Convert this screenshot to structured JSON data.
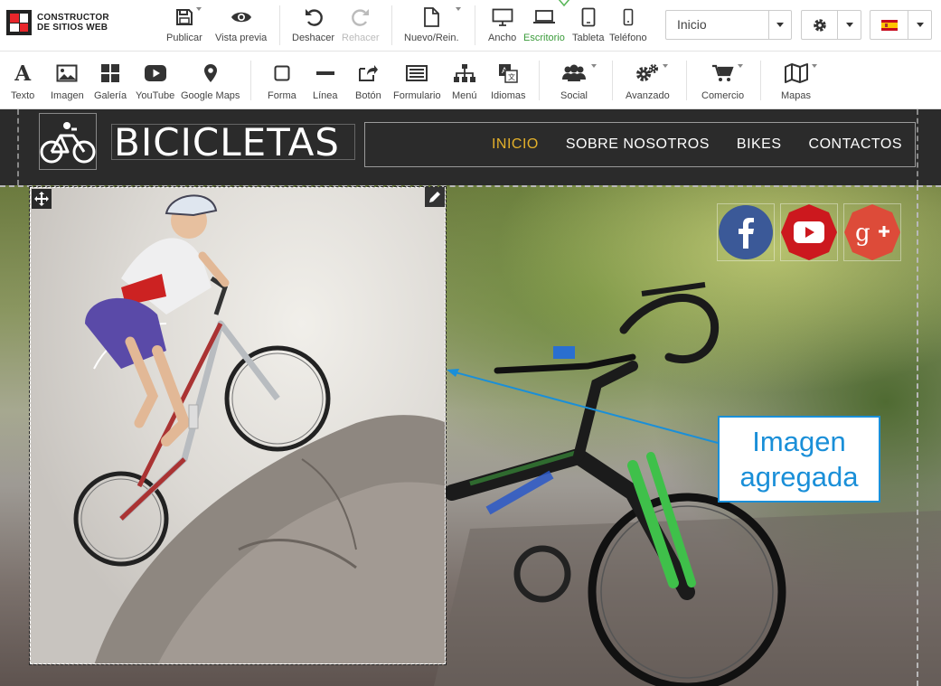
{
  "app": {
    "logo_line1": "CONSTRUCTOR",
    "logo_line2": "DE SITIOS WEB"
  },
  "topbar": {
    "publish": "Publicar",
    "preview": "Vista previa",
    "undo": "Deshacer",
    "redo": "Rehacer",
    "new_reset": "Nuevo/Rein.",
    "devices": {
      "wide": "Ancho",
      "desktop": "Escritorio",
      "tablet": "Tableta",
      "phone": "Teléfono",
      "active": "desktop"
    },
    "page_select_value": "Inicio",
    "active_color": "#3a9b3a"
  },
  "toolbar2": {
    "text": "Texto",
    "image": "Imagen",
    "gallery": "Galería",
    "youtube": "YouTube",
    "google_maps": "Google Maps",
    "shape": "Forma",
    "line": "Línea",
    "button": "Botón",
    "form": "Formulario",
    "menu": "Menú",
    "languages": "Idiomas",
    "social": "Social",
    "advanced": "Avanzado",
    "commerce": "Comercio",
    "maps": "Mapas"
  },
  "site": {
    "title": "BICICLETAS",
    "nav": [
      "INICIO",
      "SOBRE NOSOTROS",
      "BIKES",
      "CONTACTOS"
    ],
    "nav_active_color": "#e3b02a",
    "header_bg": "#2b2b2b",
    "social": {
      "facebook_color": "#3b5998",
      "youtube_color": "#cc181e",
      "googleplus_color": "#dd4b39"
    }
  },
  "annotation": {
    "line1": "Imagen",
    "line2": "agregada",
    "color": "#1a8fd8"
  }
}
